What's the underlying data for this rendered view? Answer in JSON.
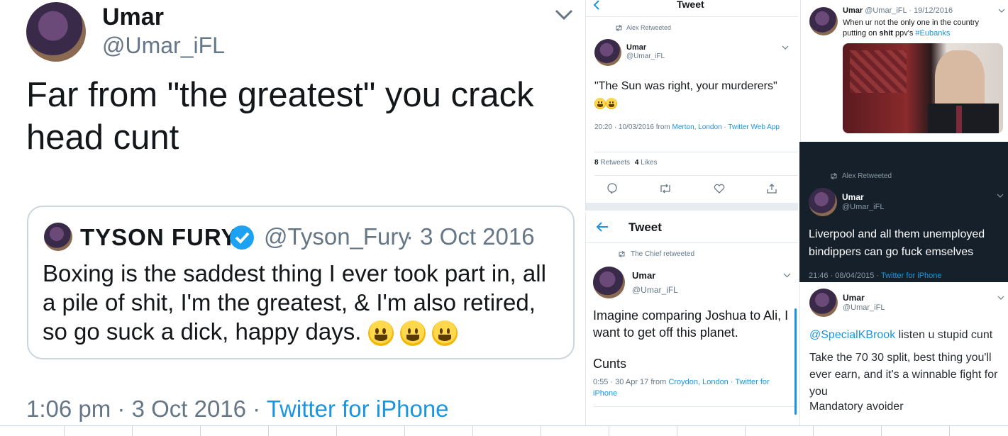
{
  "main": {
    "name": "Umar",
    "handle": "@Umar_iFL",
    "text": "Far from \"the greatest\" you crack head cunt",
    "quote": {
      "name": "TYSON FURY",
      "handle": "@Tyson_Fury",
      "date": "· 3 Oct 2016",
      "text": "Boxing is the saddest thing I ever took part in, all a pile of shit, I'm the greatest, & I'm also retired, so go suck a dick, happy days."
    },
    "time": "1:06 pm · 3 Oct 2016 ·",
    "source": "Twitter for iPhone"
  },
  "t2": {
    "header": "Tweet",
    "retweeted_by": "Alex Retweeted",
    "name": "Umar",
    "handle": "@Umar_iFL",
    "text": "\"The Sun was right, your murderers\"",
    "meta_time": "20:20 · 10/03/2016 from",
    "meta_loc1": "Merton",
    "meta_loc2": "London",
    "meta_app1": "· Twitter",
    "meta_app2": "Web App",
    "retweets_count": "8",
    "retweets_label": "Retweets",
    "likes_count": "4",
    "likes_label": "Likes"
  },
  "t3": {
    "header": "Tweet",
    "retweeted_by": "The Chief retweeted",
    "name": "Umar",
    "handle": "@Umar_iFL",
    "text": "Imagine comparing Joshua to Ali, I want to get off this planet.",
    "text2": "Cunts",
    "meta_time": "0:55 · 30 Apr 17 from",
    "meta_loc": "Croydon, London",
    "meta_app1": "· Twitter",
    "meta_app2": "for iPhone"
  },
  "t4": {
    "name": "Umar",
    "handle_date": "@Umar_iFL · 19/12/2016",
    "text1": "When ur not the only one in the country",
    "text2a": "putting on",
    "text2b": "shit",
    "text2c": "ppv's",
    "hashtag": "#Eubanks"
  },
  "t5": {
    "retweeted_by": "Alex Retweeted",
    "name": "Umar",
    "handle": "@Umar_iFL",
    "text": "Liverpool and all them unemployed bindippers can go fuck emselves",
    "time": "21:46 · 08/04/2015 ·",
    "source": "Twitter for iPhone"
  },
  "t6": {
    "name": "Umar",
    "handle": "@Umar_iFL",
    "mention": "@SpecialKBrook",
    "text1": "listen u stupid cunt",
    "text2": "Take the 70 30 split, best thing you'll ever earn, and it's a winnable fight for you",
    "text3": "Mandatory avoider"
  },
  "colors": {
    "link": "#1b95e0",
    "dark_bg": "#15202b",
    "verified": "#1da1f2"
  }
}
